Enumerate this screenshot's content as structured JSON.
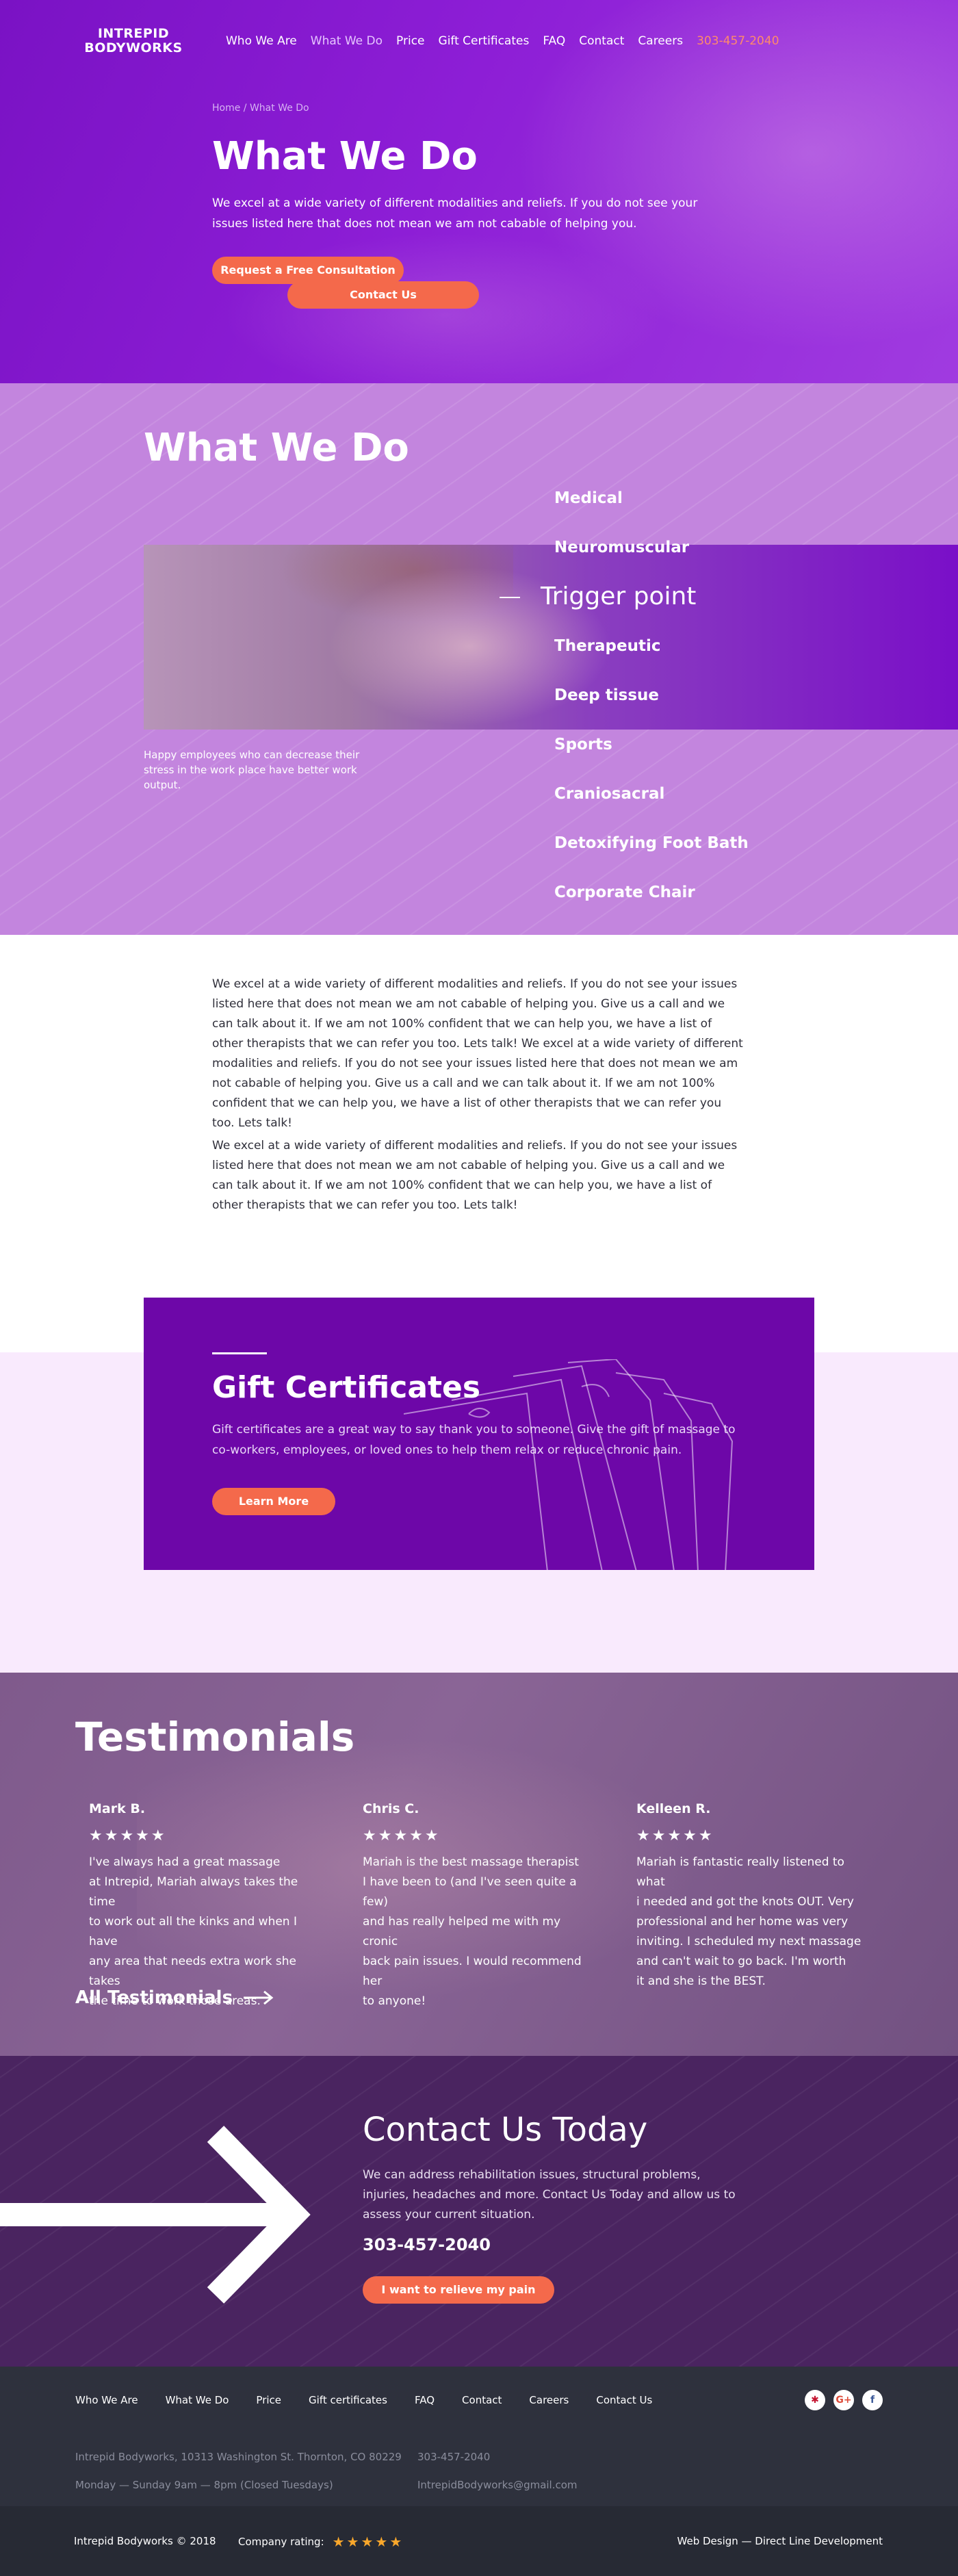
{
  "header": {
    "logo": "Intrepid Bodyworks",
    "nav": [
      "Who We Are",
      "What We Do",
      "Price",
      "Gift Certificates",
      "FAQ",
      "Contact",
      "Careers"
    ],
    "phone": "303-457-2040",
    "cta": "Contact Us"
  },
  "hero": {
    "breadcrumb": "Home / What We Do",
    "title": "What We Do",
    "intro": "We excel at a wide variety of different modalities and reliefs. If you do not see your issues listed here that does not mean we am not cabable of helping you.",
    "button": "Request a Free Consultation"
  },
  "services": {
    "title": "What We Do",
    "caption": "Happy employees who can decrease their stress in the work place have better work output.",
    "items": [
      "Medical",
      "Neuromuscular",
      "Trigger point",
      "Therapeutic",
      "Deep tissue",
      "Sports",
      "Craniosacral",
      "Detoxifying Foot Bath",
      "Corporate Chair"
    ],
    "active_item": "Trigger point"
  },
  "body_text": [
    "We excel at a wide variety of different modalities and reliefs. If you do not see your issues listed here that does not mean we am not cabable of helping you. Give us a call and we can talk about it. If we am not 100% confident that we can help you, we have a list of other therapists that we can refer you too.  Lets talk! We excel at a wide variety of different modalities and reliefs. If you do not see your issues listed here that does not mean we am not cabable of helping you. Give us a call and we can talk about it. If we am not 100% confident that we can help you, we have a list of other therapists that we can refer you too.  Lets talk!",
    "We excel at a wide variety of different modalities and reliefs. If you do not see your issues listed here that does not mean we am not cabable of helping you. Give us a call and we can talk about it. If we am not 100% confident that we can help you, we have a list of other therapists that we can refer you too.  Lets talk!"
  ],
  "gift": {
    "title": "Gift Certificates",
    "text": "Gift certificates are a great way to say thank you to someone.  Give the gift of massage to co-workers, employees, or loved ones to help them relax or reduce chronic pain.",
    "button": "Learn More"
  },
  "testimonials": {
    "title": "Testimonials",
    "items": [
      {
        "name": "Mark B.",
        "stars": "★★★★★",
        "text": "I've always had a great massage\nat Intrepid, Mariah always takes the time\nto work out all the kinks and when I have\nany area that needs extra work she takes\nthe time to work those areas."
      },
      {
        "name": "Chris C.",
        "stars": "★★★★★",
        "text": "Mariah is the best massage therapist\nI have been to (and I've seen quite a few)\nand has really helped me with my cronic\nback pain issues.  I would recommend her\nto anyone!"
      },
      {
        "name": "Kelleen R.",
        "stars": "★★★★★",
        "text": "Mariah is fantastic really listened to what\ni needed and got the knots OUT.  Very\nprofessional and her home was very\ninviting.  I scheduled my next massage\nand can't wait to go back.  I'm worth\nit and she is the BEST."
      }
    ],
    "all_link": "All Testimonials"
  },
  "contact": {
    "title": "Contact Us Today",
    "text": "We can address rehabilitation issues, structural problems, injuries, headaches and more. Contact Us Today and allow us to assess your current situation.",
    "phone": "303-457-2040",
    "button": "I want to relieve my pain"
  },
  "footer": {
    "nav": [
      "Who We Are",
      "What We Do",
      "Price",
      "Gift certificates",
      "FAQ",
      "Contact",
      "Careers",
      "Contact Us"
    ],
    "address": "Intrepid Bodyworks, 10313 Washington St. Thornton, CO 80229",
    "hours": "Monday — Sunday 9am — 8pm (Closed Tuesdays)",
    "phone": "303-457-2040",
    "email": "IntrepidBodyworks@gmail.com",
    "social": [
      "yelp-icon",
      "google-plus-icon",
      "facebook-icon"
    ],
    "copyright": "Intrepid Bodyworks © 2018",
    "rating_label": "Company rating:",
    "rating_stars": "★★★★★",
    "credit": "Web Design — Direct Line Development"
  },
  "colors": {
    "primary": "#7a12c4",
    "accent": "#f4694b",
    "lavender": "#c385de",
    "footer": "#2e313d"
  }
}
